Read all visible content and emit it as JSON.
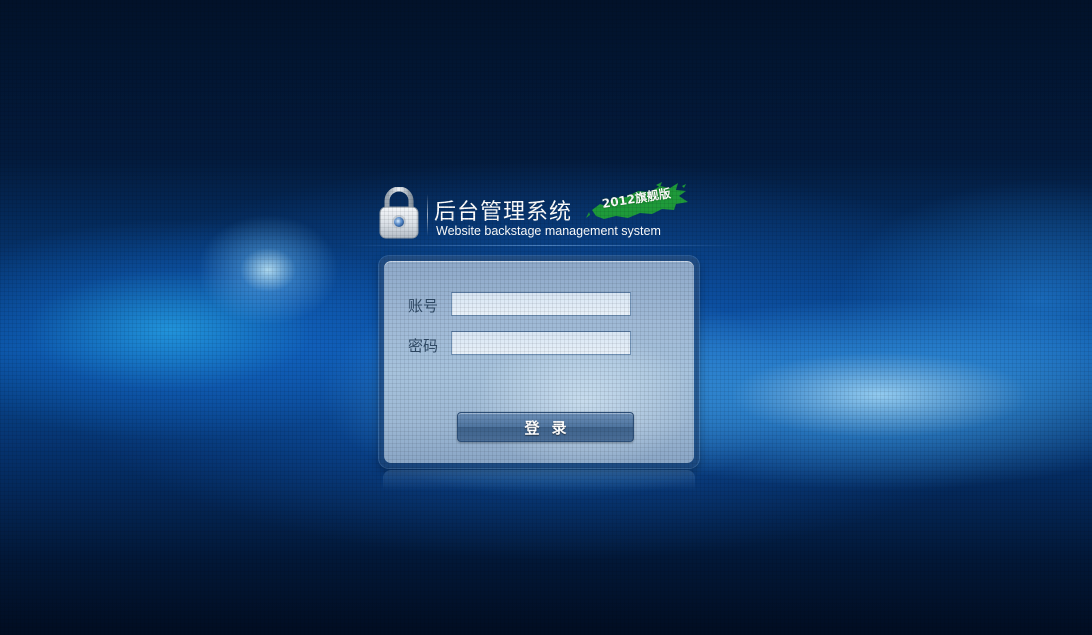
{
  "header": {
    "title": "后台管理系统",
    "subtitle": "Website backstage management system",
    "edition_badge": "2012旗舰版",
    "lock_icon": "lock-icon",
    "badge_color": "#1e9a3a"
  },
  "login_form": {
    "account_label": "账号",
    "account_value": "",
    "password_label": "密码",
    "password_value": "",
    "submit_label": "登录"
  },
  "colors": {
    "background_primary": "#063a7a",
    "panel": "#a6c2dc",
    "button": "#4e749f"
  }
}
